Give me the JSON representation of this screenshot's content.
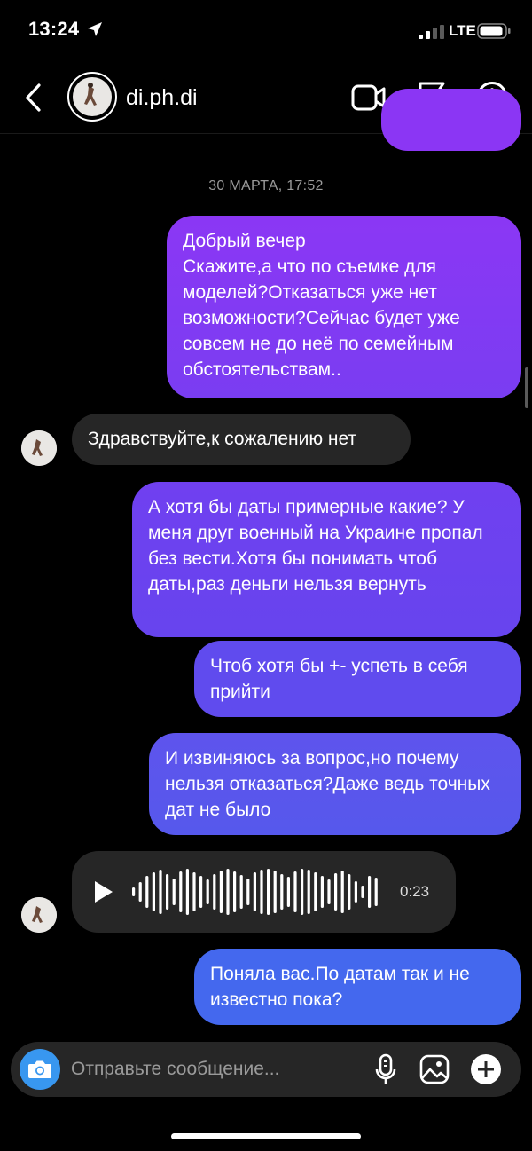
{
  "status_bar": {
    "time": "13:24",
    "network": "LTE"
  },
  "header": {
    "username": "di.ph.di"
  },
  "timestamp": "30 МАРТА, 17:52",
  "messages": [
    {
      "text": "Добрый вечер\nСкажите,а что по съемке для моделей?Отказаться уже нет возможности?Сейчас будет уже совсем не до неё по семейным обстоятельствам.."
    },
    {
      "text": "Здравствуйте,к сожалению нет"
    },
    {
      "text": "А хотя бы даты примерные какие? У меня друг военный на Украине пропал без вести.Хотя бы понимать чтоб даты,раз деньги нельзя вернуть"
    },
    {
      "text": "Чтоб хотя бы +- успеть в себя прийти"
    },
    {
      "text": "И извиняюсь за вопрос,но почему нельзя отказаться?Даже ведь точных дат не было"
    },
    {
      "voice_duration": "0:23"
    },
    {
      "text": "Поняла вас.По датам так и не известно пока?"
    }
  ],
  "composer": {
    "placeholder": "Отправьте сообщение..."
  },
  "colors": {
    "outgoing_top": "#8a38f5",
    "outgoing_bottom": "#3e6ff0",
    "incoming": "#262626",
    "camera": "#3897f0"
  }
}
